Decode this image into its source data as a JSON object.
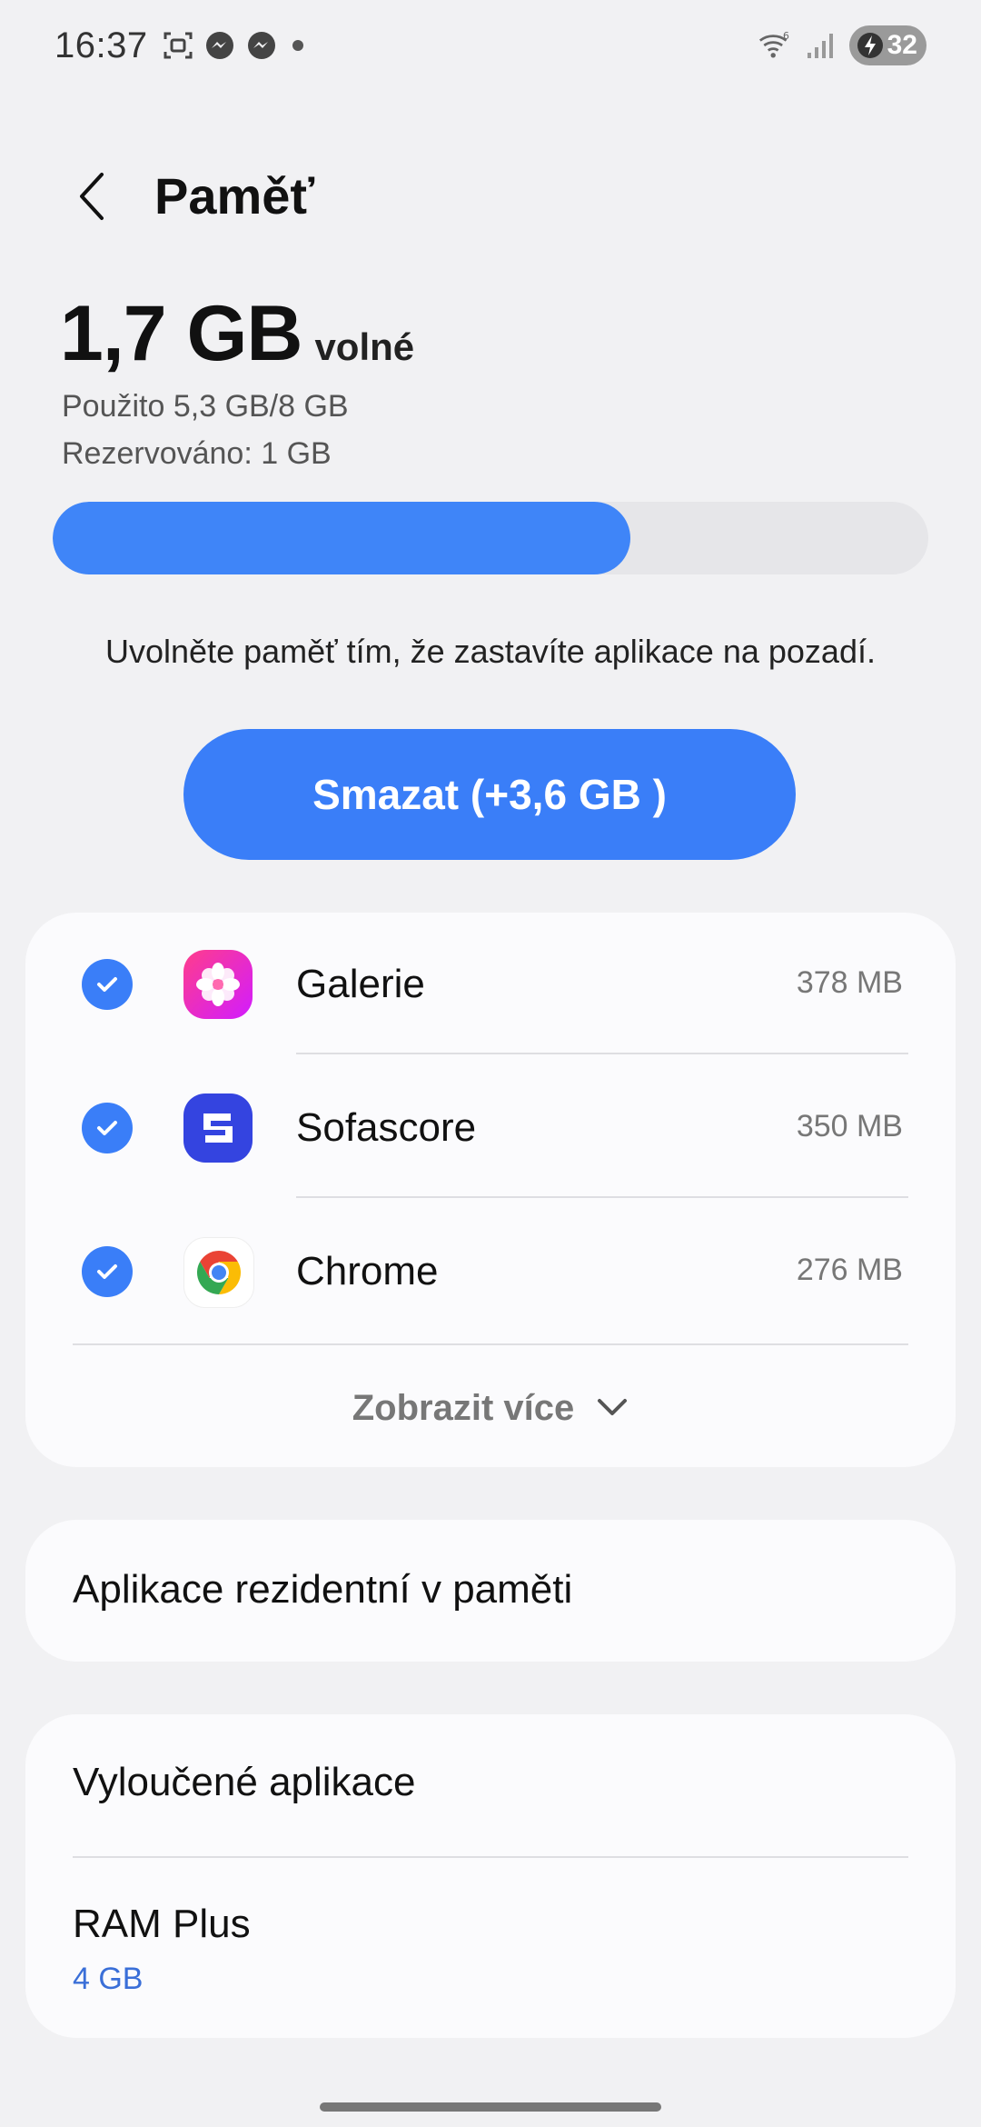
{
  "status_bar": {
    "time": "16:37",
    "battery": "32",
    "icons": [
      "screenshot-icon",
      "messenger-icon",
      "messenger-icon",
      "notification-dot",
      "wifi-icon",
      "signal-icon",
      "battery-charging-icon"
    ]
  },
  "header": {
    "title": "Paměť"
  },
  "memory": {
    "free_value": "1,7 GB",
    "free_label": "volné",
    "used": "Použito 5,3 GB/8 GB",
    "reserved": "Rezervováno: 1 GB",
    "usage_fraction": 0.66
  },
  "hint": "Uvolněte paměť tím, že zastavíte aplikace na pozadí.",
  "clear_button": "Smazat (+3,6 GB )",
  "apps": [
    {
      "name": "Galerie",
      "size": "378 MB",
      "checked": true,
      "icon": "gallery-icon"
    },
    {
      "name": "Sofascore",
      "size": "350 MB",
      "checked": true,
      "icon": "sofascore-icon"
    },
    {
      "name": "Chrome",
      "size": "276 MB",
      "checked": true,
      "icon": "chrome-icon"
    }
  ],
  "show_more": "Zobrazit více",
  "resident_apps": "Aplikace rezidentní v paměti",
  "excluded_apps": "Vyloučené aplikace",
  "ram_plus": {
    "label": "RAM Plus",
    "value": "4 GB"
  },
  "colors": {
    "accent": "#3a7ef8",
    "progress_fill": "#3f85f8",
    "background": "#f1f1f3",
    "card": "#fbfbfd",
    "link": "#3a6fd8"
  }
}
